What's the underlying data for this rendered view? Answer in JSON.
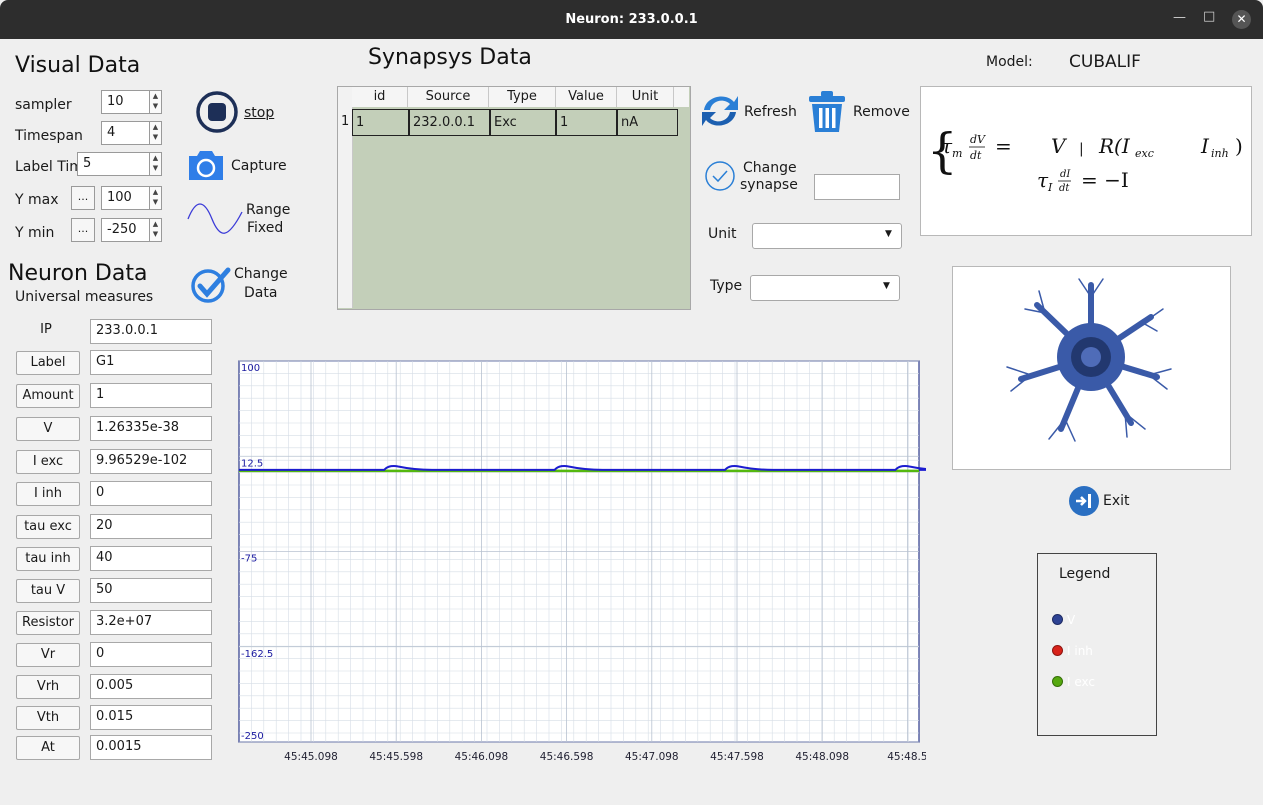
{
  "window": {
    "title": "Neuron: 233.0.0.1"
  },
  "visual": {
    "title": "Visual Data",
    "sampler": {
      "label": "sampler",
      "value": "10"
    },
    "timespan": {
      "label": "Timespan",
      "value": "4"
    },
    "label_time": {
      "label": "Label Time",
      "value": "5"
    },
    "ymax": {
      "label": "Y max",
      "dots": "...",
      "value": "100"
    },
    "ymin": {
      "label": "Y min",
      "dots": "...",
      "value": "-250"
    }
  },
  "actions": {
    "stop": "stop",
    "capture": "Capture",
    "range_line1": "Range",
    "range_line2": "Fixed",
    "change_line1": "Change",
    "change_line2": "Data"
  },
  "neuron": {
    "title": "Neuron Data",
    "subtitle": "Universal measures",
    "fields": [
      {
        "label": "IP",
        "value": "233.0.0.1"
      },
      {
        "label": "Label",
        "value": "G1"
      },
      {
        "label": "Amount",
        "value": "1"
      },
      {
        "label": "V",
        "value": "1.26335e-38"
      },
      {
        "label": "I exc",
        "value": "9.96529e-102"
      },
      {
        "label": "I inh",
        "value": "0"
      },
      {
        "label": "tau exc",
        "value": "20"
      },
      {
        "label": "tau inh",
        "value": "40"
      },
      {
        "label": "tau V",
        "value": "50"
      },
      {
        "label": "Resistor",
        "value": "3.2e+07"
      },
      {
        "label": "Vr",
        "value": "0"
      },
      {
        "label": "Vrh",
        "value": "0.005"
      },
      {
        "label": "Vth",
        "value": "0.015"
      },
      {
        "label": "At",
        "value": "0.0015"
      }
    ]
  },
  "synapsys": {
    "title": "Synapsys Data",
    "columns": [
      "id",
      "Source",
      "Type",
      "Value",
      "Unit"
    ],
    "rows": [
      {
        "row_num": "1",
        "id": "1",
        "source": "232.0.0.1",
        "type": "Exc",
        "value": "1",
        "unit": "nA"
      }
    ],
    "refresh": "Refresh",
    "remove": "Remove",
    "change_line1": "Change",
    "change_line2": "synapse",
    "change_value": "",
    "unit_label": "Unit",
    "unit_value": "",
    "type_label": "Type",
    "type_value": ""
  },
  "model": {
    "label": "Model:",
    "name": "CUBALIF"
  },
  "exit": "Exit",
  "legend": {
    "title": "Legend",
    "items": [
      {
        "label": "V",
        "color": "#2e4394"
      },
      {
        "label": "I inh",
        "color": "#d8221a"
      },
      {
        "label": "I exc",
        "color": "#55a80f"
      }
    ]
  },
  "chart_data": {
    "type": "line",
    "ylim": [
      -250,
      100
    ],
    "y_ticks": [
      "100",
      "12.5",
      "-75",
      "-162.5",
      "-250"
    ],
    "x_ticks": [
      "45:45.098",
      "45:45.598",
      "45:46.098",
      "45:46.598",
      "45:47.098",
      "45:47.598",
      "45:48.098",
      "45:48.5"
    ],
    "series": [
      {
        "name": "V",
        "color": "#1c1cd0",
        "baseline": 0,
        "spike_peak": 4,
        "spike_times": [
          "45:45.598",
          "45:46.598",
          "45:47.598",
          "45:48.5"
        ]
      },
      {
        "name": "I exc",
        "color": "#55b80f",
        "baseline": 0
      }
    ]
  }
}
